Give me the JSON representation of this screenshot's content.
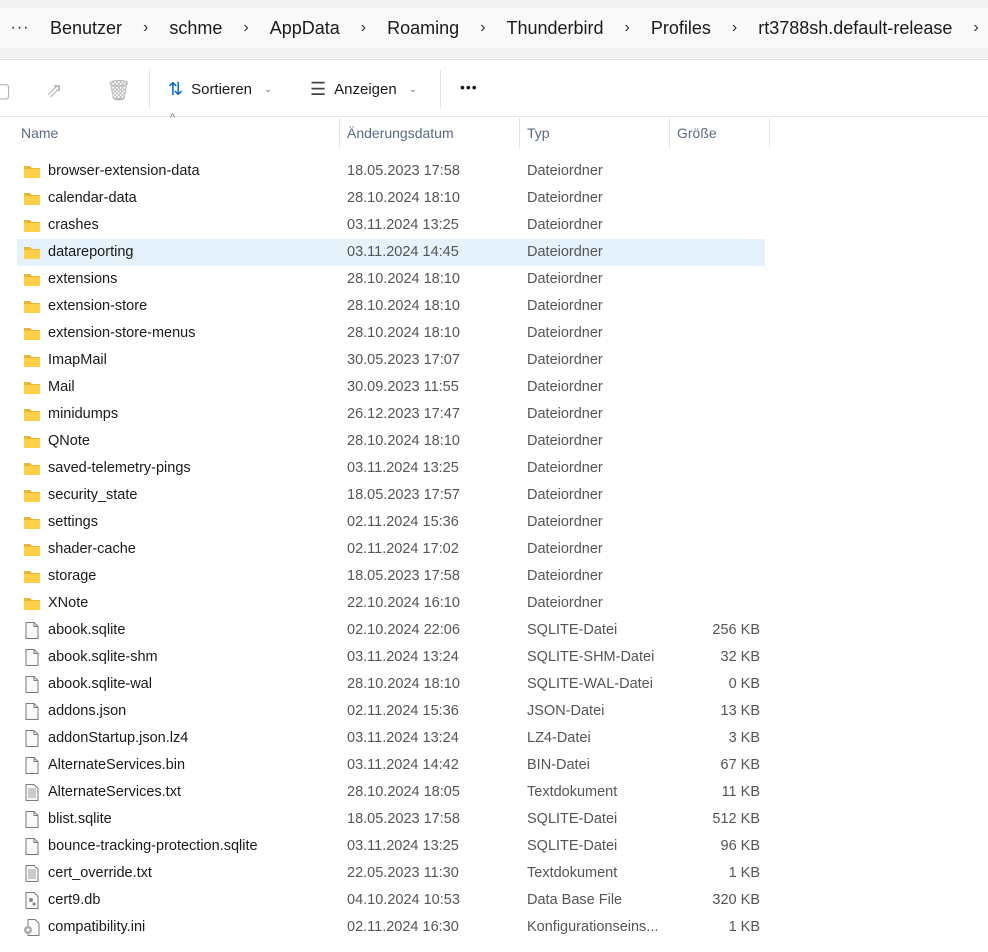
{
  "breadcrumb": {
    "overflow": "···",
    "items": [
      "Benutzer",
      "schme",
      "AppData",
      "Roaming",
      "Thunderbird",
      "Profiles",
      "rt3788sh.default-release"
    ]
  },
  "toolbar": {
    "sort_label": "Sortieren",
    "view_label": "Anzeigen",
    "more": "•••"
  },
  "columns": {
    "name": "Name",
    "date": "Änderungsdatum",
    "type": "Typ",
    "size": "Größe"
  },
  "accent": "#0067c0",
  "files": [
    {
      "name": "browser-extension-data",
      "date": "18.05.2023 17:58",
      "type": "Dateiordner",
      "size": "",
      "icon": "folder"
    },
    {
      "name": "calendar-data",
      "date": "28.10.2024 18:10",
      "type": "Dateiordner",
      "size": "",
      "icon": "folder"
    },
    {
      "name": "crashes",
      "date": "03.11.2024 13:25",
      "type": "Dateiordner",
      "size": "",
      "icon": "folder"
    },
    {
      "name": "datareporting",
      "date": "03.11.2024 14:45",
      "type": "Dateiordner",
      "size": "",
      "icon": "folder",
      "selected": true
    },
    {
      "name": "extensions",
      "date": "28.10.2024 18:10",
      "type": "Dateiordner",
      "size": "",
      "icon": "folder"
    },
    {
      "name": "extension-store",
      "date": "28.10.2024 18:10",
      "type": "Dateiordner",
      "size": "",
      "icon": "folder"
    },
    {
      "name": "extension-store-menus",
      "date": "28.10.2024 18:10",
      "type": "Dateiordner",
      "size": "",
      "icon": "folder"
    },
    {
      "name": "ImapMail",
      "date": "30.05.2023 17:07",
      "type": "Dateiordner",
      "size": "",
      "icon": "folder"
    },
    {
      "name": "Mail",
      "date": "30.09.2023 11:55",
      "type": "Dateiordner",
      "size": "",
      "icon": "folder"
    },
    {
      "name": "minidumps",
      "date": "26.12.2023 17:47",
      "type": "Dateiordner",
      "size": "",
      "icon": "folder"
    },
    {
      "name": "QNote",
      "date": "28.10.2024 18:10",
      "type": "Dateiordner",
      "size": "",
      "icon": "folder"
    },
    {
      "name": "saved-telemetry-pings",
      "date": "03.11.2024 13:25",
      "type": "Dateiordner",
      "size": "",
      "icon": "folder"
    },
    {
      "name": "security_state",
      "date": "18.05.2023 17:57",
      "type": "Dateiordner",
      "size": "",
      "icon": "folder"
    },
    {
      "name": "settings",
      "date": "02.11.2024 15:36",
      "type": "Dateiordner",
      "size": "",
      "icon": "folder"
    },
    {
      "name": "shader-cache",
      "date": "02.11.2024 17:02",
      "type": "Dateiordner",
      "size": "",
      "icon": "folder"
    },
    {
      "name": "storage",
      "date": "18.05.2023 17:58",
      "type": "Dateiordner",
      "size": "",
      "icon": "folder"
    },
    {
      "name": "XNote",
      "date": "22.10.2024 16:10",
      "type": "Dateiordner",
      "size": "",
      "icon": "folder"
    },
    {
      "name": "abook.sqlite",
      "date": "02.10.2024 22:06",
      "type": "SQLITE-Datei",
      "size": "256 KB",
      "icon": "file"
    },
    {
      "name": "abook.sqlite-shm",
      "date": "03.11.2024 13:24",
      "type": "SQLITE-SHM-Datei",
      "size": "32 KB",
      "icon": "file"
    },
    {
      "name": "abook.sqlite-wal",
      "date": "28.10.2024 18:10",
      "type": "SQLITE-WAL-Datei",
      "size": "0 KB",
      "icon": "file"
    },
    {
      "name": "addons.json",
      "date": "02.11.2024 15:36",
      "type": "JSON-Datei",
      "size": "13 KB",
      "icon": "file"
    },
    {
      "name": "addonStartup.json.lz4",
      "date": "03.11.2024 13:24",
      "type": "LZ4-Datei",
      "size": "3 KB",
      "icon": "file"
    },
    {
      "name": "AlternateServices.bin",
      "date": "03.11.2024 14:42",
      "type": "BIN-Datei",
      "size": "67 KB",
      "icon": "file"
    },
    {
      "name": "AlternateServices.txt",
      "date": "28.10.2024 18:05",
      "type": "Textdokument",
      "size": "11 KB",
      "icon": "text"
    },
    {
      "name": "blist.sqlite",
      "date": "18.05.2023 17:58",
      "type": "SQLITE-Datei",
      "size": "512 KB",
      "icon": "file"
    },
    {
      "name": "bounce-tracking-protection.sqlite",
      "date": "03.11.2024 13:25",
      "type": "SQLITE-Datei",
      "size": "96 KB",
      "icon": "file"
    },
    {
      "name": "cert_override.txt",
      "date": "22.05.2023 11:30",
      "type": "Textdokument",
      "size": "1 KB",
      "icon": "text"
    },
    {
      "name": "cert9.db",
      "date": "04.10.2024 10:53",
      "type": "Data Base File",
      "size": "320 KB",
      "icon": "db"
    },
    {
      "name": "compatibility.ini",
      "date": "02.11.2024 16:30",
      "type": "Konfigurationseins...",
      "size": "1 KB",
      "icon": "ini"
    }
  ]
}
